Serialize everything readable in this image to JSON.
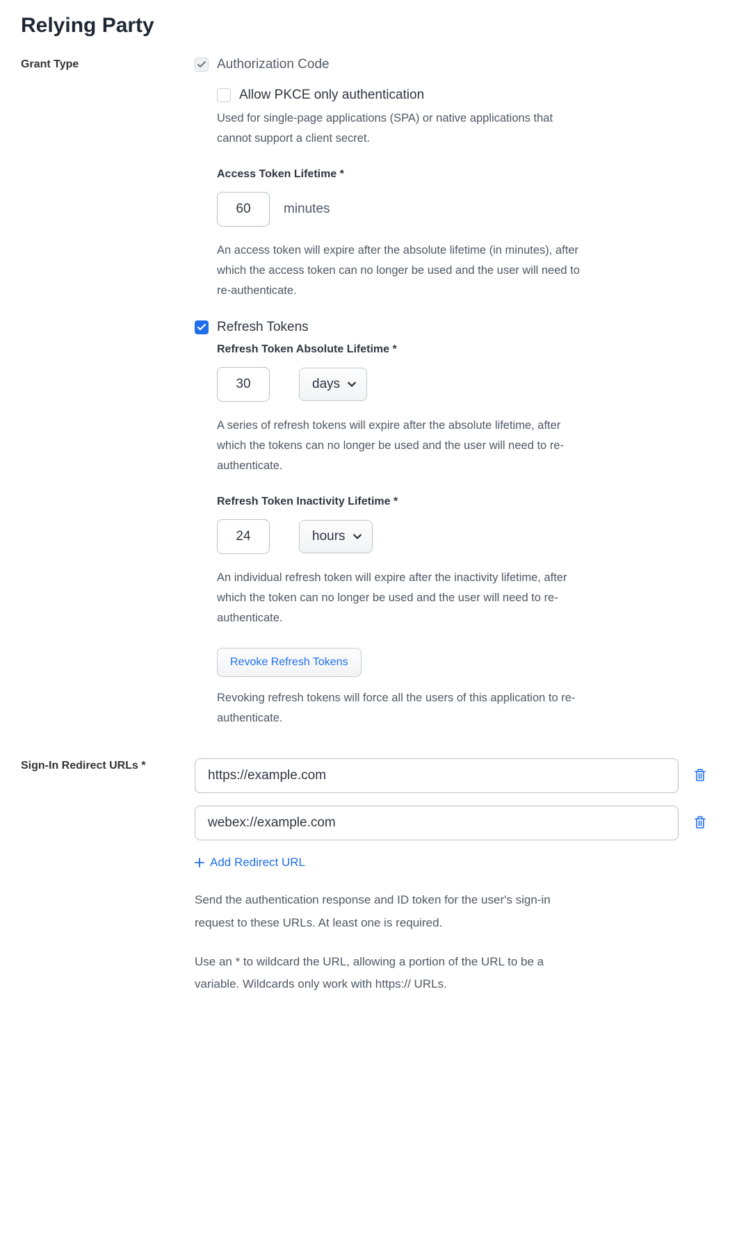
{
  "title": "Relying Party",
  "grant_type": {
    "label": "Grant Type",
    "auth_code": {
      "label": "Authorization Code",
      "checked": true,
      "pkce": {
        "label": "Allow PKCE only authentication",
        "checked": false,
        "help": "Used for single-page applications (SPA) or native applications that cannot support a client secret."
      },
      "access_token": {
        "label": "Access Token Lifetime *",
        "value": "60",
        "unit": "minutes",
        "help": "An access token will expire after the absolute lifetime (in minutes), after which the access token can no longer be used and the user will need to re-authenticate."
      }
    },
    "refresh_tokens": {
      "label": "Refresh Tokens",
      "checked": true,
      "absolute": {
        "label": "Refresh Token Absolute Lifetime *",
        "value": "30",
        "unit": "days",
        "help": "A series of refresh tokens will expire after the absolute lifetime, after which the tokens can no longer be used and the user will need to re-authenticate."
      },
      "inactivity": {
        "label": "Refresh Token Inactivity Lifetime *",
        "value": "24",
        "unit": "hours",
        "help": "An individual refresh token will expire after the inactivity lifetime, after which the token can no longer be used and the user will need to re-authenticate."
      },
      "revoke": {
        "button": "Revoke Refresh Tokens",
        "help": "Revoking refresh tokens will force all the users of this application to re-authenticate."
      }
    }
  },
  "redirect_urls": {
    "label": "Sign-In Redirect URLs *",
    "items": [
      "https://example.com",
      "webex://example.com"
    ],
    "add_label": "Add Redirect URL",
    "help1": "Send the authentication response and ID token for the user's sign-in request to these URLs. At least one is required.",
    "help2": "Use an * to wildcard the URL, allowing a portion of the URL to be a variable. Wildcards only work with https:// URLs."
  }
}
